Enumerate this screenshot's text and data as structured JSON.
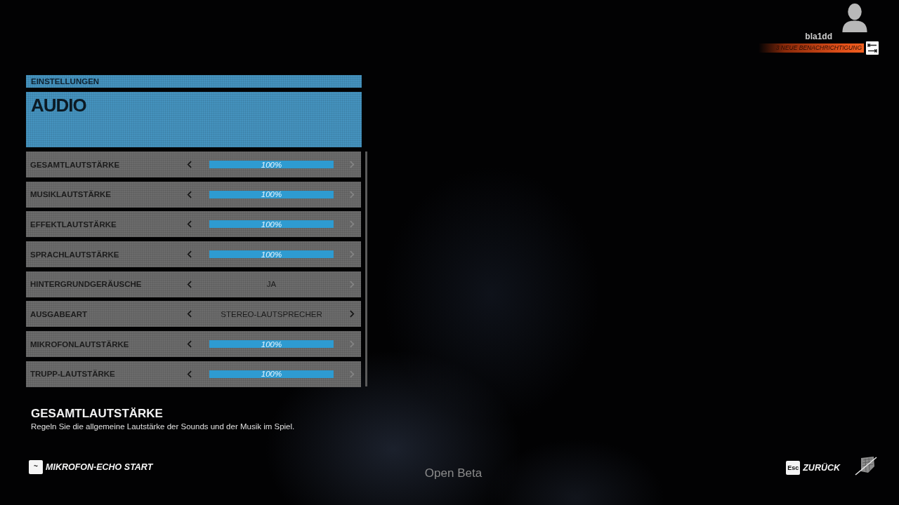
{
  "user": {
    "name": "bla1dd",
    "notification": "3 NEUE BENACHRICHTIGUNG"
  },
  "panel": {
    "section": "EINSTELLUNGEN",
    "title": "AUDIO"
  },
  "settings": [
    {
      "kind": "slider",
      "label": "GESAMTLAUTSTÄRKE",
      "level": 1,
      "reading": "100%",
      "prev_disabled": false,
      "next_disabled": true
    },
    {
      "kind": "slider",
      "label": "MUSIKLAUTSTÄRKE",
      "level": 1,
      "reading": "100%",
      "prev_disabled": false,
      "next_disabled": true
    },
    {
      "kind": "slider",
      "label": "EFFEKTLAUTSTÄRKE",
      "level": 1,
      "reading": "100%",
      "prev_disabled": false,
      "next_disabled": true
    },
    {
      "kind": "slider",
      "label": "SPRACHLAUTSTÄRKE",
      "level": 1,
      "reading": "100%",
      "prev_disabled": false,
      "next_disabled": true
    },
    {
      "kind": "choice",
      "label": "HINTERGRUNDGERÄUSCHE",
      "value": "JA",
      "prev_disabled": false,
      "next_disabled": true
    },
    {
      "kind": "choice",
      "label": "AUSGABEART",
      "value": "STEREO-LAUTSPRECHER",
      "prev_disabled": false,
      "next_disabled": false
    },
    {
      "kind": "slider",
      "label": "MIKROFONLAUTSTÄRKE",
      "level": 1,
      "reading": "100%",
      "prev_disabled": false,
      "next_disabled": true
    },
    {
      "kind": "slider",
      "label": "TRUPP-LAUTSTÄRKE",
      "level": 1,
      "reading": "100%",
      "prev_disabled": false,
      "next_disabled": true
    }
  ],
  "description": {
    "title": "GESAMTLAUTSTÄRKE",
    "text": "Regeln Sie die allgemeine Lautstärke der Sounds und der Musik im Spiel."
  },
  "footer": {
    "left_action": {
      "key": "~",
      "label": "MIKROFON-ECHO START"
    },
    "build": "Open Beta",
    "right_action": {
      "key": "Esc",
      "label": "ZURÜCK"
    }
  }
}
